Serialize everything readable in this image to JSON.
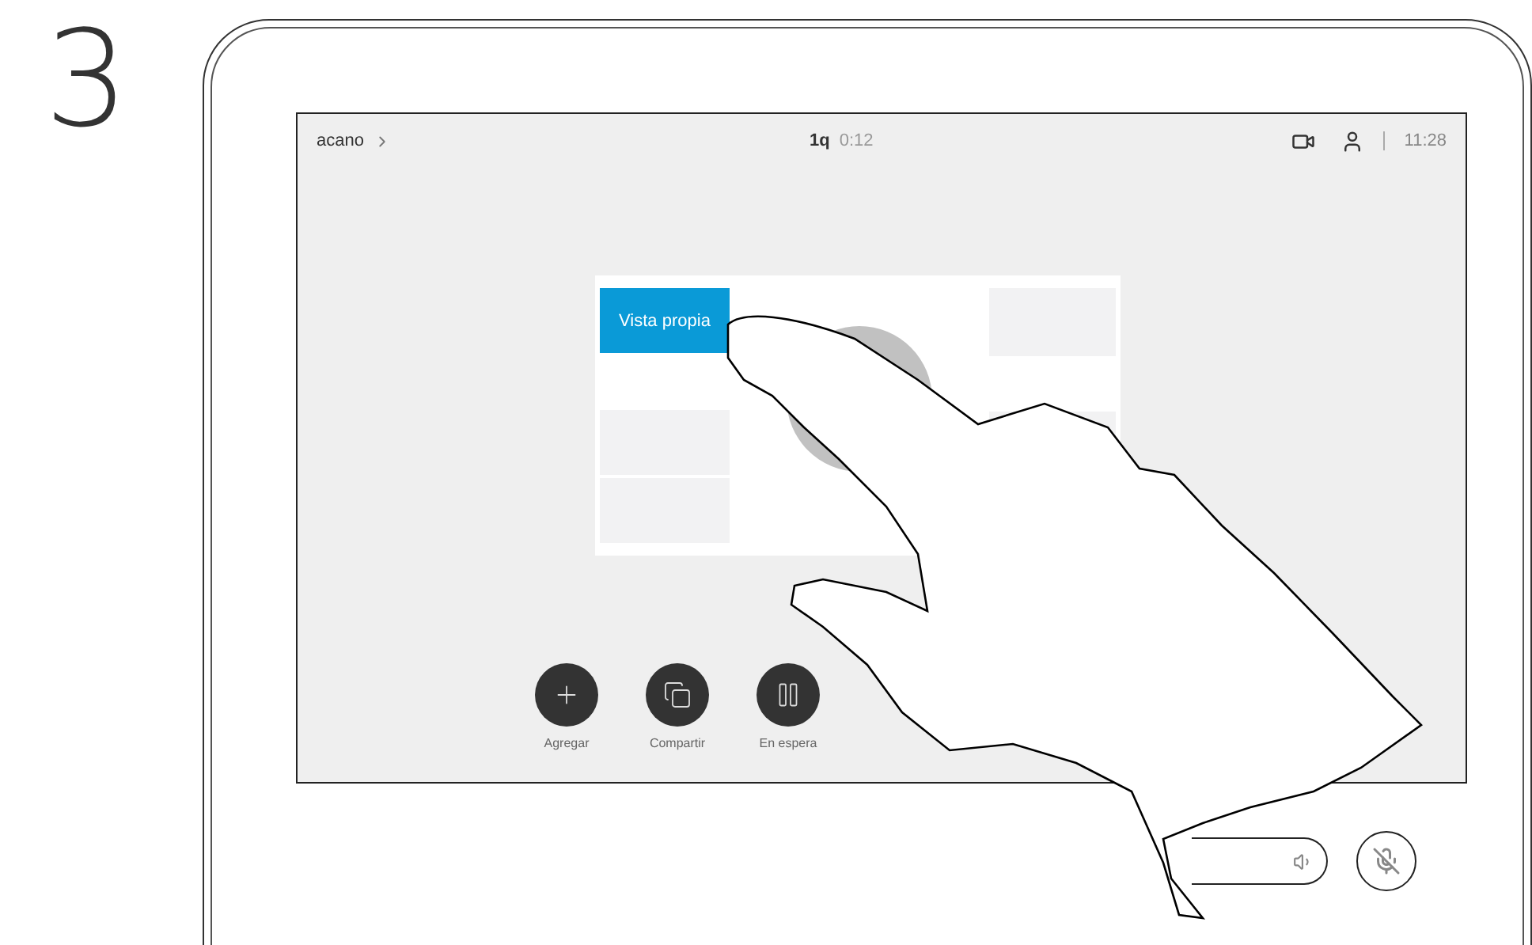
{
  "step": "3",
  "top_bar": {
    "title": "acano",
    "caller": "1q",
    "duration": "0:12",
    "time": "11:28"
  },
  "video_panel": {
    "self_view_label": "Vista propia"
  },
  "call_buttons": [
    {
      "kind": "add",
      "label": "Agregar"
    },
    {
      "kind": "share",
      "label": "Compartir"
    },
    {
      "kind": "hold",
      "label": "En espera"
    }
  ]
}
